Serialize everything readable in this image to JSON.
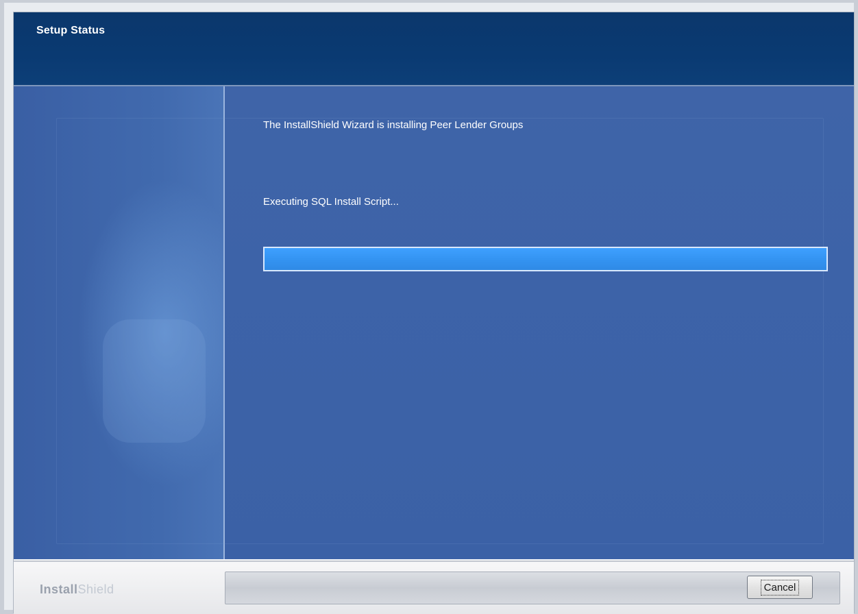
{
  "header": {
    "title": "Setup Status"
  },
  "content": {
    "message": "The InstallShield Wizard is installing Peer Lender Groups",
    "status": "Executing SQL Install Script...",
    "progress_percent": 100
  },
  "footer": {
    "brand_part1": "Install",
    "brand_part2": "Shield",
    "cancel_label": "Cancel"
  },
  "colors": {
    "header_bg": "#0b376c",
    "body_bg": "#3f64a8",
    "progress_fill": "#3494f2"
  }
}
